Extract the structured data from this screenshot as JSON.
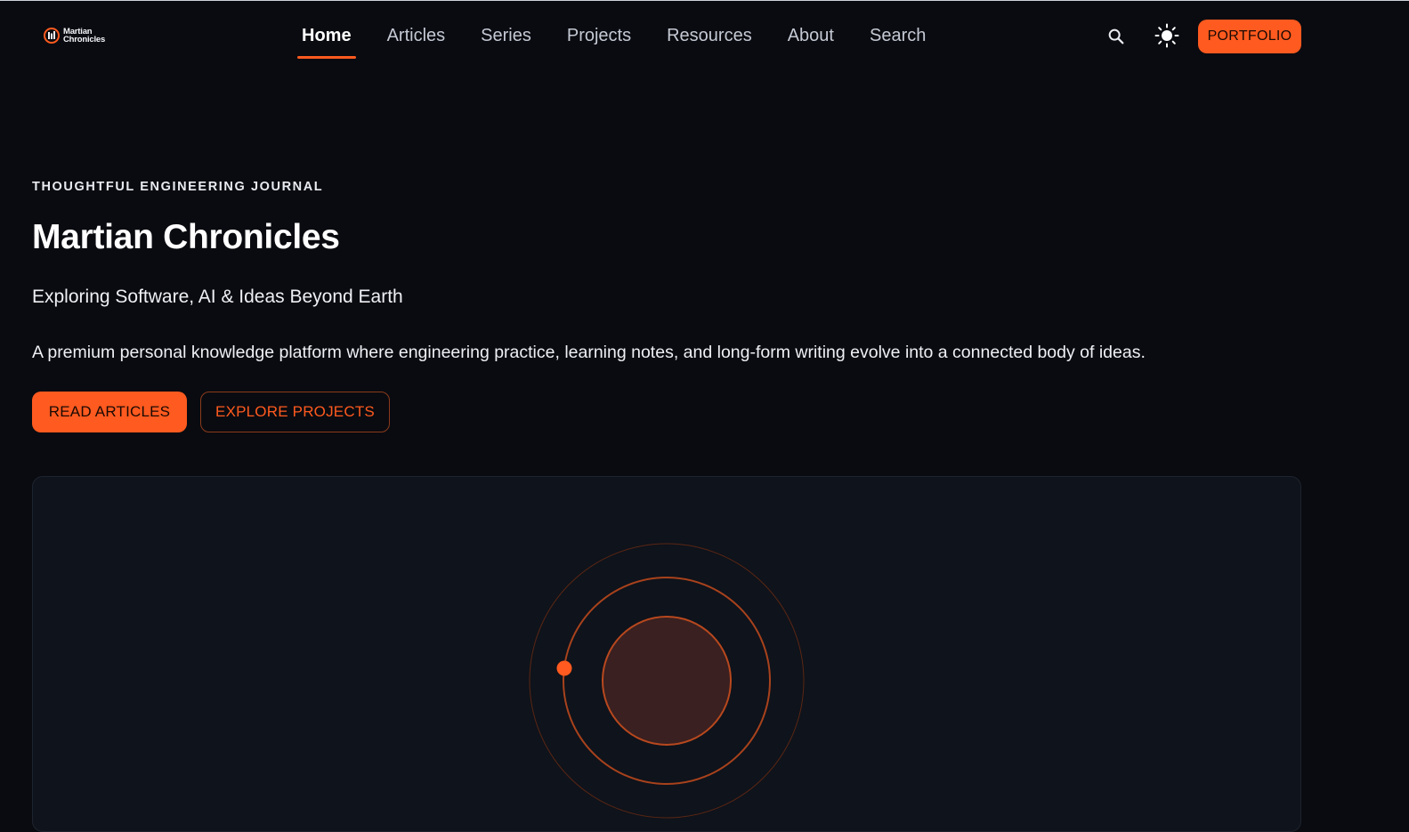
{
  "brand": {
    "name_line1": "Martian",
    "name_line2": "Chronicles",
    "accent": "#ff5a1f",
    "background": "#0a0b10"
  },
  "nav": {
    "items": [
      {
        "label": "Home",
        "active": true
      },
      {
        "label": "Articles",
        "active": false
      },
      {
        "label": "Series",
        "active": false
      },
      {
        "label": "Projects",
        "active": false
      },
      {
        "label": "Resources",
        "active": false
      },
      {
        "label": "About",
        "active": false
      },
      {
        "label": "Search",
        "active": false
      }
    ],
    "search_icon": "search-icon",
    "theme_icon": "sun-icon",
    "portfolio_label": "PORTFOLIO"
  },
  "hero": {
    "eyebrow": "THOUGHTFUL ENGINEERING JOURNAL",
    "title": "Martian Chronicles",
    "subtitle": "Exploring Software, AI & Ideas Beyond Earth",
    "description": "A premium personal knowledge platform where engineering practice, learning notes, and long-form writing evolve into a connected body of ideas.",
    "primary_cta": "READ ARTICLES",
    "secondary_cta": "EXPLORE PROJECTS"
  },
  "visual": {
    "planet_fill": "#3a2020",
    "orbit_color": "#b0441d"
  }
}
